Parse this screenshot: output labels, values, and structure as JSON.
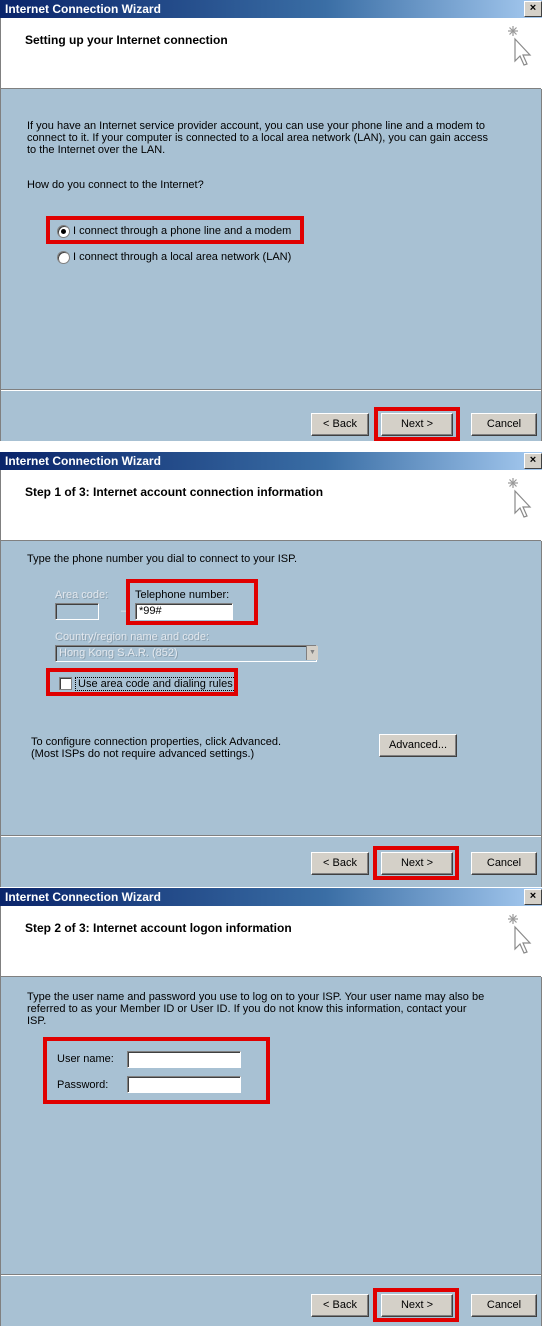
{
  "window_title": "Internet Connection Wizard",
  "close_glyph": "×",
  "icon": "wizard-cursor-sparkle-icon",
  "buttons": {
    "back": "< Back",
    "next": "Next >",
    "cancel": "Cancel",
    "advanced": "Advanced..."
  },
  "highlight_color": "#e00000",
  "panel1": {
    "header": "Setting up your Internet connection",
    "intro": "If you have an Internet service provider account, you can use your phone line and a modem to connect to it. If your computer is connected to a local area network (LAN), you can gain access to the Internet over the LAN.",
    "question": "How do you connect to the Internet?",
    "option_phone": "I connect through a phone line and a modem",
    "option_lan": "I connect through a local area network (LAN)",
    "selected": "option_phone"
  },
  "panel2": {
    "header": "Step 1 of 3: Internet account connection information",
    "intro": "Type the phone number you dial to connect to your ISP.",
    "area_code_label": "Area code:",
    "area_code_value": "",
    "phone_label": "Telephone number:",
    "phone_value": "*99#",
    "country_label": "Country/region name and code:",
    "country_value": "Hong Kong S.A.R. (852)",
    "dialing_rules_label": "Use area code and dialing rules",
    "dialing_rules_checked": false,
    "advanced_text_1": "To configure connection properties, click Advanced.",
    "advanced_text_2": "(Most ISPs do not require advanced settings.)"
  },
  "panel3": {
    "header": "Step 2 of 3: Internet account logon information",
    "intro": "Type the user name and password you use to log on to your ISP. Your user name may also be referred to as your Member ID or User ID. If you do not know this information, contact your ISP.",
    "username_label": "User name:",
    "username_value": "",
    "password_label": "Password:",
    "password_value": ""
  }
}
